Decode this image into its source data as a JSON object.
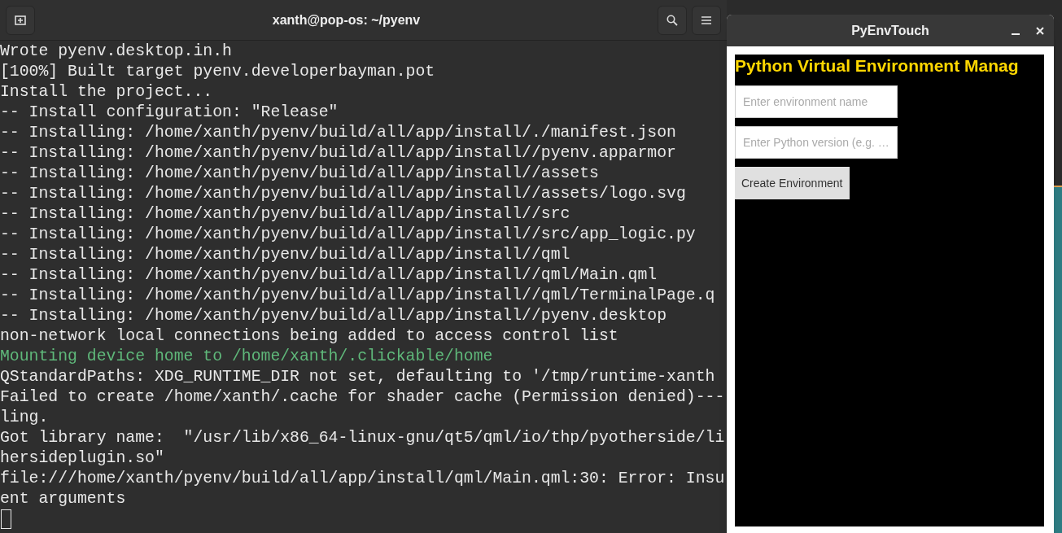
{
  "terminal": {
    "title": "xanth@pop-os: ~/pyenv",
    "lines": [
      {
        "kind": "output",
        "text": "Wrote pyenv.desktop.in.h"
      },
      {
        "kind": "output",
        "text": "[100%] Built target pyenv.developerbayman.pot"
      },
      {
        "kind": "output",
        "text": "Install the project..."
      },
      {
        "kind": "output",
        "text": "-- Install configuration: \"Release\""
      },
      {
        "kind": "output",
        "text": "-- Installing: /home/xanth/pyenv/build/all/app/install/./manifest.json"
      },
      {
        "kind": "output",
        "text": "-- Installing: /home/xanth/pyenv/build/all/app/install//pyenv.apparmor"
      },
      {
        "kind": "output",
        "text": "-- Installing: /home/xanth/pyenv/build/all/app/install//assets"
      },
      {
        "kind": "output",
        "text": "-- Installing: /home/xanth/pyenv/build/all/app/install//assets/logo.svg"
      },
      {
        "kind": "output",
        "text": "-- Installing: /home/xanth/pyenv/build/all/app/install//src"
      },
      {
        "kind": "output",
        "text": "-- Installing: /home/xanth/pyenv/build/all/app/install//src/app_logic.py"
      },
      {
        "kind": "output",
        "text": "-- Installing: /home/xanth/pyenv/build/all/app/install//qml"
      },
      {
        "kind": "output",
        "text": "-- Installing: /home/xanth/pyenv/build/all/app/install//qml/Main.qml"
      },
      {
        "kind": "output",
        "text": "-- Installing: /home/xanth/pyenv/build/all/app/install//qml/TerminalPage.q"
      },
      {
        "kind": "output",
        "text": "-- Installing: /home/xanth/pyenv/build/all/app/install//pyenv.desktop"
      },
      {
        "kind": "output",
        "text": "non-network local connections being added to access control list"
      },
      {
        "kind": "info",
        "text": "Mounting device home to /home/xanth/.clickable/home"
      },
      {
        "kind": "output",
        "text": "QStandardPaths: XDG_RUNTIME_DIR not set, defaulting to '/tmp/runtime-xanth"
      },
      {
        "kind": "output",
        "text": "Failed to create /home/xanth/.cache for shader cache (Permission denied)---"
      },
      {
        "kind": "output",
        "text": "ling."
      },
      {
        "kind": "output",
        "text": "Got library name:  \"/usr/lib/x86_64-linux-gnu/qt5/qml/io/thp/pyotherside/li"
      },
      {
        "kind": "output",
        "text": "hersideplugin.so\""
      },
      {
        "kind": "output",
        "text": "file:///home/xanth/pyenv/build/all/app/install/qml/Main.qml:30: Error: Insu"
      },
      {
        "kind": "output",
        "text": "ent arguments"
      }
    ]
  },
  "app": {
    "title": "PyEnvTouch",
    "heading": "Python Virtual Environment Manag",
    "fields": [
      {
        "placeholder": "Enter environment name"
      },
      {
        "placeholder": "Enter Python version (e.g. …"
      }
    ],
    "button": "Create Environment"
  }
}
